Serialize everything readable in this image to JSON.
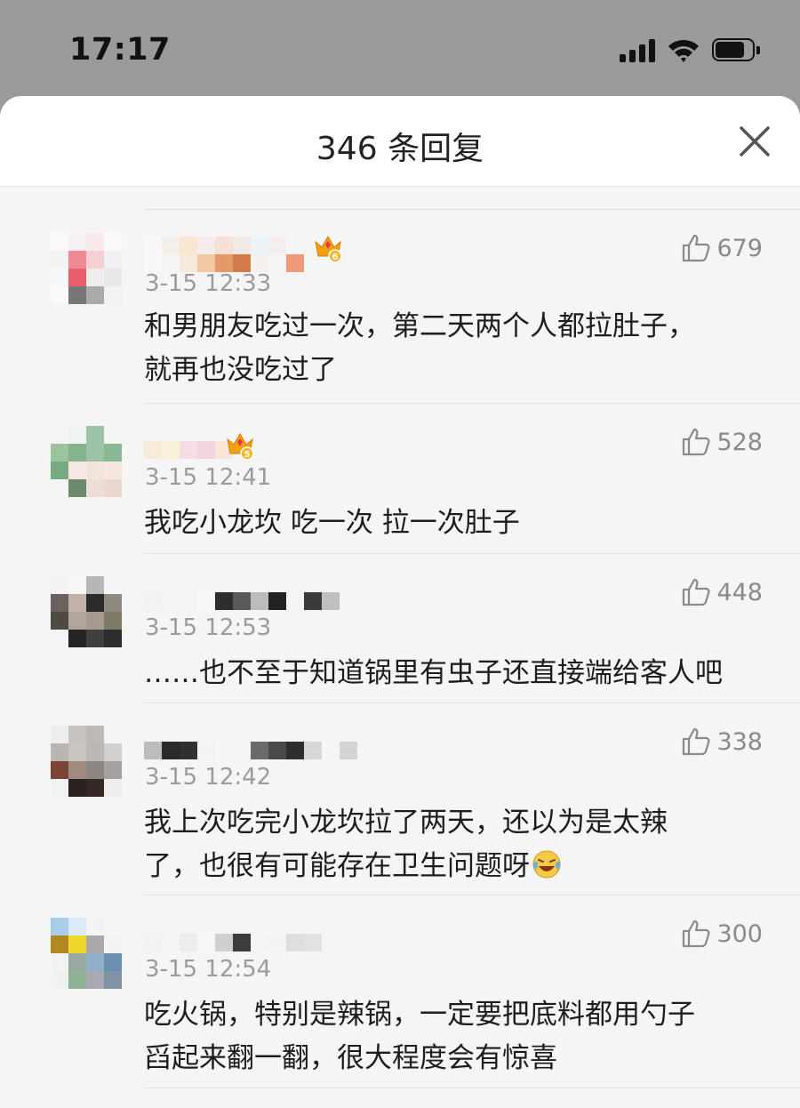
{
  "status_bar": {
    "time": "17:17"
  },
  "header": {
    "title": "346 条回复"
  },
  "comments": [
    {
      "timestamp": "3-15 12:33",
      "text_lines": [
        "和男朋友吃过一次，第二天两个人都拉肚子，",
        "就再也没吃过了"
      ],
      "likes": "679",
      "has_badge": true,
      "badge_level": "6"
    },
    {
      "timestamp": "3-15 12:41",
      "text_lines": [
        "我吃小龙坎 吃一次 拉一次肚子"
      ],
      "likes": "528",
      "has_badge": true,
      "badge_level": "5"
    },
    {
      "timestamp": "3-15 12:53",
      "text_lines": [
        "……也不至于知道锅里有虫子还直接端给客人吧"
      ],
      "likes": "448",
      "has_badge": false
    },
    {
      "timestamp": "3-15 12:42",
      "text_lines": [
        "我上次吃完小龙坎拉了两天，还以为是太辣",
        "了，也很有可能存在卫生问题呀"
      ],
      "likes": "338",
      "has_badge": false,
      "emoji": "laughing-crying"
    },
    {
      "timestamp": "3-15 12:54",
      "text_lines": [
        "吃火锅，特别是辣锅，一定要把底料都用勺子",
        "舀起来翻一翻，很大程度会有惊喜"
      ],
      "likes": "300",
      "has_badge": false
    }
  ]
}
